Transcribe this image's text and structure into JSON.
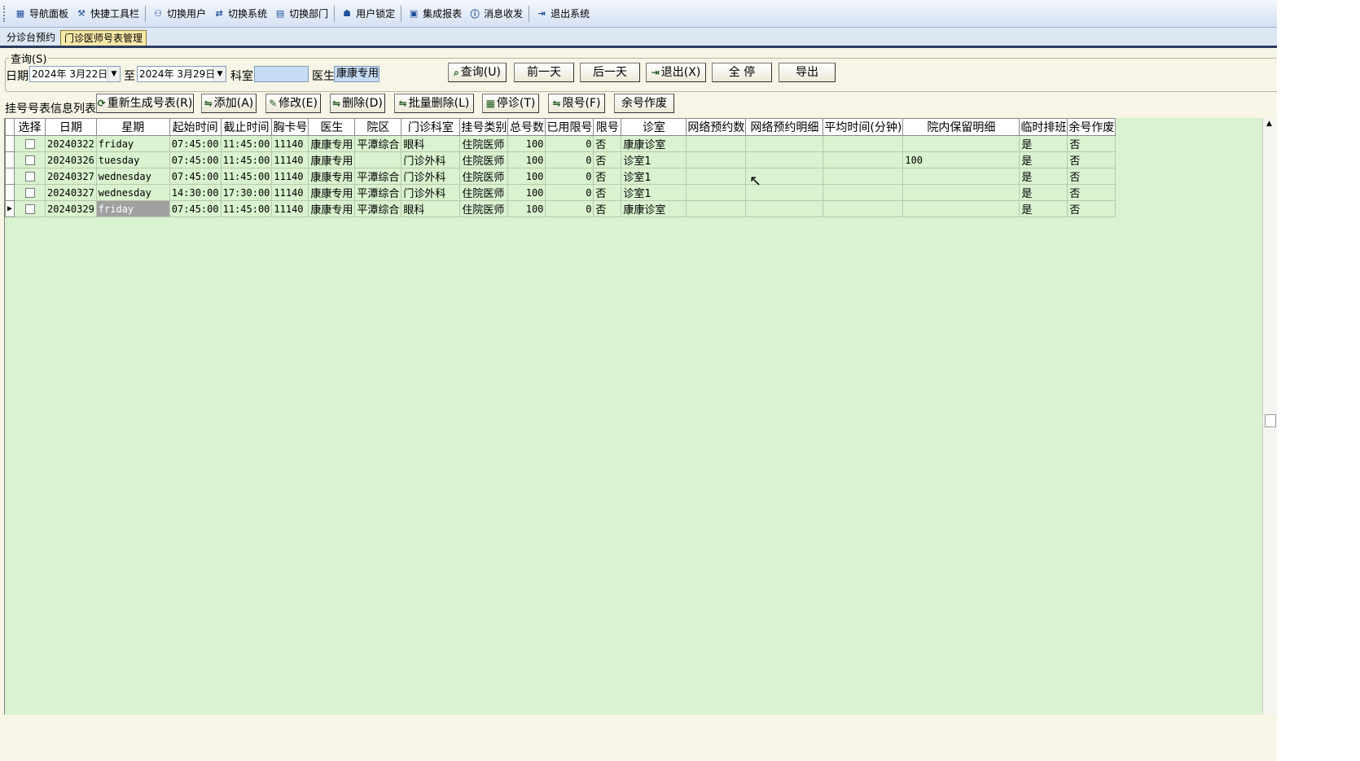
{
  "toolbar": {
    "items": [
      {
        "label": "导航面板",
        "icon": "dashboard-icon"
      },
      {
        "label": "快捷工具栏",
        "icon": "tools-icon"
      },
      {
        "label": "切换用户",
        "icon": "switch-user-icon"
      },
      {
        "label": "切换系统",
        "icon": "switch-system-icon"
      },
      {
        "label": "切换部门",
        "icon": "department-icon"
      },
      {
        "label": "用户锁定",
        "icon": "lock-user-icon"
      },
      {
        "label": "集成报表",
        "icon": "report-icon"
      },
      {
        "label": "消息收发",
        "icon": "message-icon"
      },
      {
        "label": "退出系统",
        "icon": "exit-icon"
      }
    ]
  },
  "tabs": [
    {
      "label": "分诊台预约",
      "active": false
    },
    {
      "label": "门诊医师号表管理",
      "active": true
    }
  ],
  "query": {
    "legend": "查询(S)",
    "date_label": "日期",
    "date_from": "2024年  3月22日",
    "to_label": "至",
    "date_to": "2024年  3月29日",
    "dept_label": "科室",
    "dept_value": "",
    "doctor_label": "医生",
    "doctor_value": "康康专用",
    "buttons": {
      "query": "查询(U)",
      "prev_day": "前一天",
      "next_day": "后一天",
      "exit": "退出(X)",
      "stop_all": "全 停",
      "export": "导出"
    }
  },
  "list": {
    "label": "挂号号表信息列表:",
    "buttons": {
      "regenerate": "重新生成号表(R)",
      "add": "添加(A)",
      "edit": "修改(E)",
      "delete": "删除(D)",
      "batch_delete": "批量删除(L)",
      "suspend": "停诊(T)",
      "limit": "限号(F)",
      "void_remaining": "余号作废"
    }
  },
  "grid": {
    "columns": [
      "选择",
      "日期",
      "星期",
      "起始时间",
      "截止时间",
      "胸卡号",
      "医生",
      "院区",
      "门诊科室",
      "挂号类别",
      "总号数",
      "已用限号",
      "限号",
      "诊室",
      "网络预约数",
      "网络预约明细",
      "平均时间(分钟)",
      "院内保留明细",
      "临时排班",
      "余号作废"
    ],
    "rows": [
      [
        "",
        "20240322",
        "friday",
        "07:45:00",
        "11:45:00",
        "11140",
        "康康专用",
        "平潭综合",
        "眼科",
        "住院医师",
        "100",
        "0",
        "否",
        "康康诊室",
        "",
        "",
        "",
        "",
        "是",
        "否"
      ],
      [
        "",
        "20240326",
        "tuesday",
        "07:45:00",
        "11:45:00",
        "11140",
        "康康专用",
        "",
        "门诊外科",
        "住院医师",
        "100",
        "0",
        "否",
        "诊室1",
        "",
        "",
        "",
        "100",
        "是",
        "否"
      ],
      [
        "",
        "20240327",
        "wednesday",
        "07:45:00",
        "11:45:00",
        "11140",
        "康康专用",
        "平潭综合",
        "门诊外科",
        "住院医师",
        "100",
        "0",
        "否",
        "诊室1",
        "",
        "",
        "",
        "",
        "是",
        "否"
      ],
      [
        "",
        "20240327",
        "wednesday",
        "14:30:00",
        "17:30:00",
        "11140",
        "康康专用",
        "平潭综合",
        "门诊外科",
        "住院医师",
        "100",
        "0",
        "否",
        "诊室1",
        "",
        "",
        "",
        "",
        "是",
        "否"
      ],
      [
        "",
        "20240329",
        "friday",
        "07:45:00",
        "11:45:00",
        "11140",
        "康康专用",
        "平潭综合",
        "眼科",
        "住院医师",
        "100",
        "0",
        "否",
        "康康诊室",
        "",
        "",
        "",
        "",
        "是",
        "否"
      ]
    ],
    "current_row": 4
  }
}
